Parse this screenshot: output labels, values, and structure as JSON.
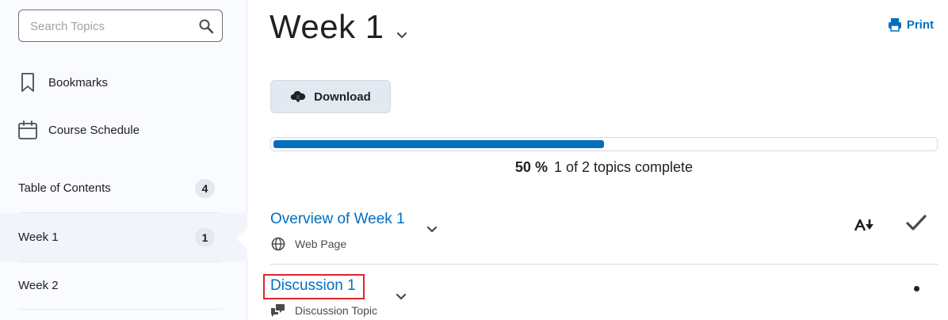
{
  "sidebar": {
    "search": {
      "placeholder": "Search Topics",
      "value": ""
    },
    "links": [
      {
        "label": "Bookmarks",
        "icon": "bookmark-icon"
      },
      {
        "label": "Course Schedule",
        "icon": "calendar-icon"
      }
    ],
    "toc": [
      {
        "label": "Table of Contents",
        "count": "4"
      },
      {
        "label": "Week 1",
        "count": "1",
        "active": true
      },
      {
        "label": "Week 2"
      }
    ]
  },
  "main": {
    "title": "Week 1",
    "print_label": "Print",
    "download_label": "Download",
    "progress": {
      "percent_value": 50,
      "percent_label": "50 %",
      "summary": "1 of 2 topics complete"
    },
    "topics": [
      {
        "title": "Overview of Week 1",
        "type": "Web Page",
        "type_icon": "globe-icon",
        "status": "completed"
      },
      {
        "title": "Discussion 1",
        "type": "Discussion Topic",
        "type_icon": "discussion-icon",
        "status": "not-started"
      }
    ]
  },
  "colors": {
    "accent": "#006fbf",
    "highlight": "#e0232b",
    "badge_bg": "#e3e9f1"
  }
}
